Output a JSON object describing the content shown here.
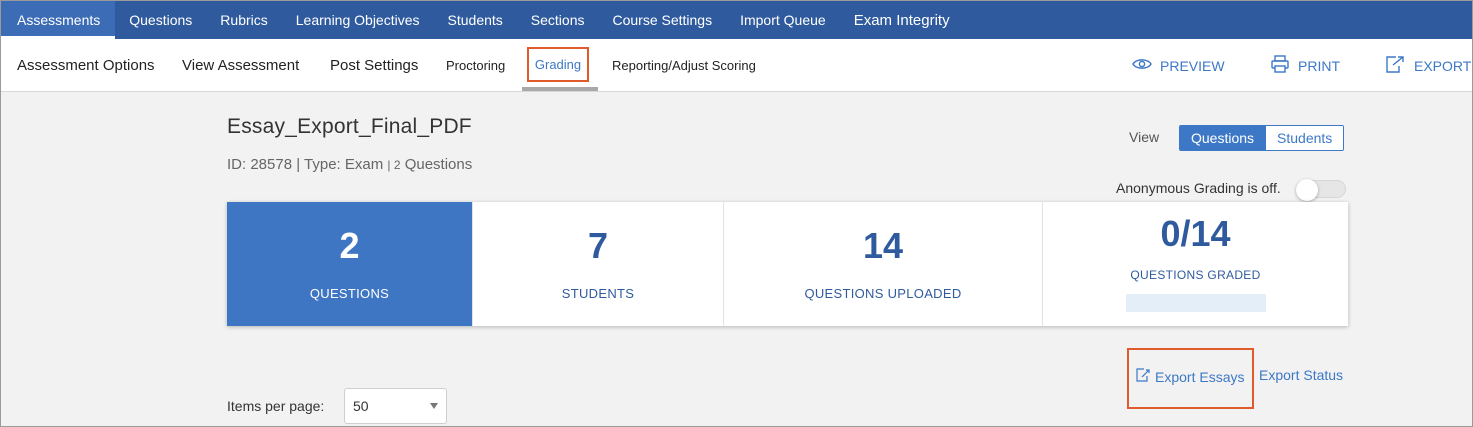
{
  "topnav": {
    "tabs": [
      {
        "label": "Assessments",
        "active": true
      },
      {
        "label": "Questions"
      },
      {
        "label": "Rubrics"
      },
      {
        "label": "Learning Objectives"
      },
      {
        "label": "Students"
      },
      {
        "label": "Sections"
      },
      {
        "label": "Course Settings"
      },
      {
        "label": "Import Queue"
      },
      {
        "label": "Exam Integrity"
      }
    ]
  },
  "subnav": {
    "tabs": [
      {
        "label": "Assessment Options"
      },
      {
        "label": "View Assessment"
      },
      {
        "label": "Post Settings"
      },
      {
        "label": "Proctoring"
      },
      {
        "label": "Grading",
        "active": true
      },
      {
        "label": "Reporting/Adjust Scoring"
      }
    ],
    "actions": {
      "preview": "PREVIEW",
      "print": "PRINT",
      "export": "EXPORT"
    }
  },
  "assessment": {
    "title": "Essay_Export_Final_PDF",
    "id_text": "ID: 28578",
    "type_text": "Type: Exam",
    "questions_count": "2",
    "questions_word": "Questions"
  },
  "view": {
    "label": "View",
    "options": [
      "Questions",
      "Students"
    ],
    "selected": "Questions"
  },
  "anonymous_grading": {
    "label": "Anonymous Grading is off.",
    "enabled": false
  },
  "stats": [
    {
      "value": "2",
      "label": "QUESTIONS"
    },
    {
      "value": "7",
      "label": "STUDENTS"
    },
    {
      "value": "14",
      "label": "QUESTIONS UPLOADED"
    },
    {
      "value": "0/14",
      "label": "QUESTIONS GRADED",
      "progress": 0
    }
  ],
  "exports": {
    "essays": "Export Essays",
    "status": "Export Status"
  },
  "pagination": {
    "items_per_page_label": "Items per page:",
    "items_per_page_value": "50"
  },
  "colors": {
    "nav_blue": "#2f5b9e",
    "accent_blue": "#3d78c7",
    "highlight_orange": "#e05a2b"
  }
}
